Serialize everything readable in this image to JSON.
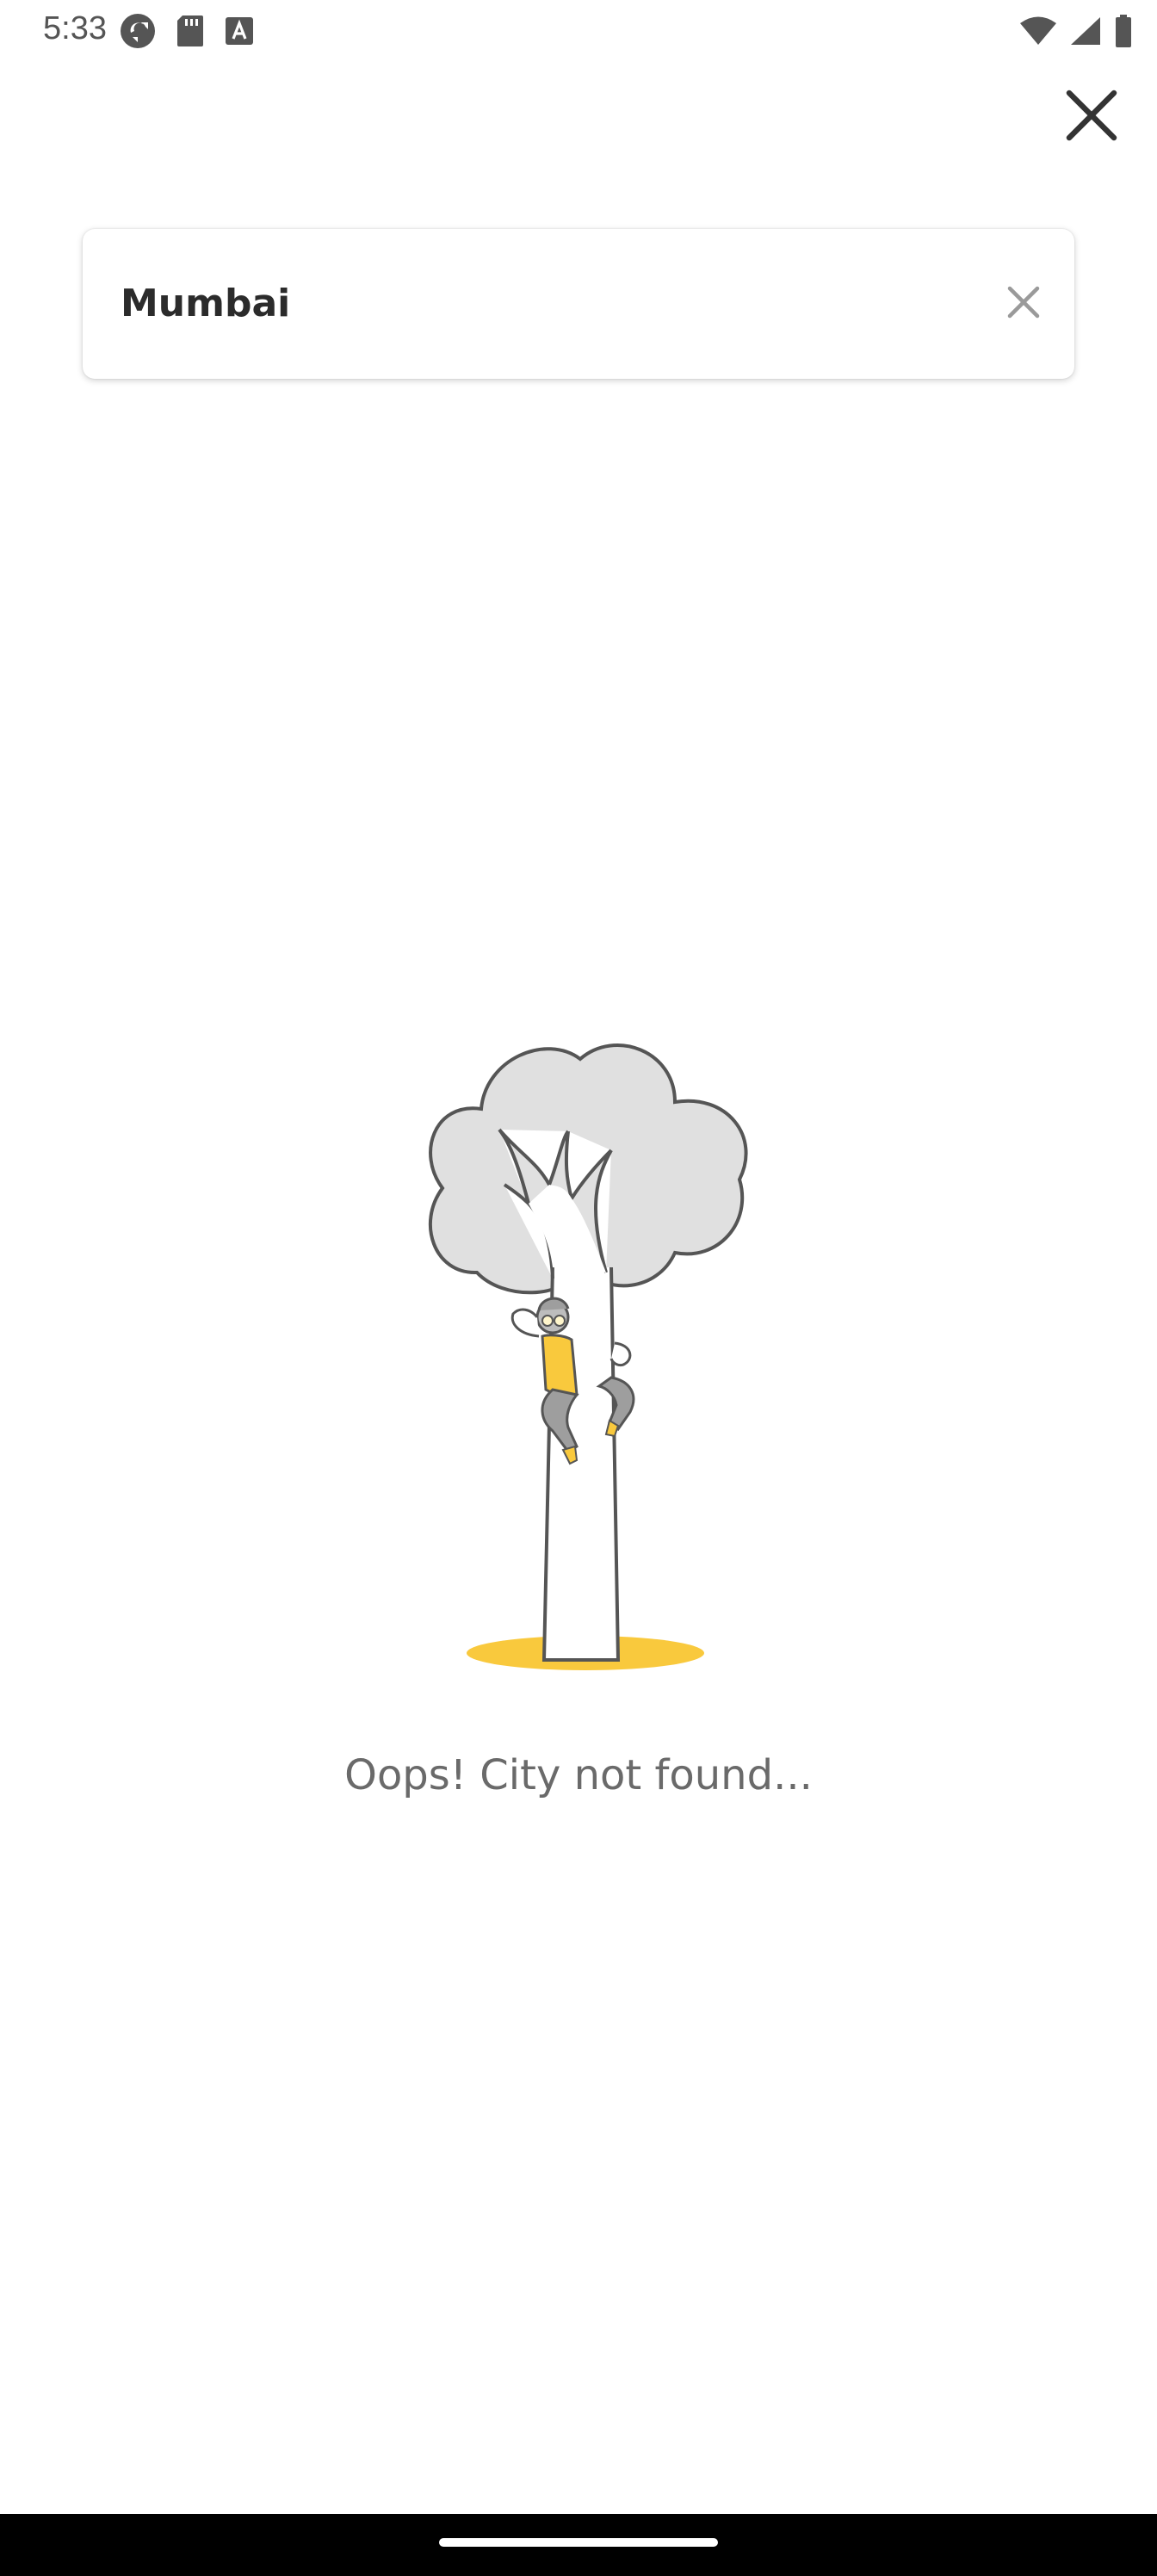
{
  "status_bar": {
    "time": "5:33",
    "left_icons": [
      "sync-icon",
      "sd-card-icon",
      "keyboard-a-icon"
    ],
    "right_icons": [
      "wifi-icon",
      "cell-signal-icon",
      "battery-icon"
    ]
  },
  "close_button": {
    "icon": "close-icon"
  },
  "search": {
    "value": "Mumbai",
    "clear_icon": "clear-icon"
  },
  "empty_state": {
    "illustration": "person-climbing-tree-illustration",
    "message": "Oops! City not found..."
  },
  "colors": {
    "accent_yellow": "#F9C93D",
    "tree_gray": "#E0E0E0",
    "outline_gray": "#555555",
    "text_dark": "#2B2B2B",
    "text_muted": "#6A6A6A"
  }
}
